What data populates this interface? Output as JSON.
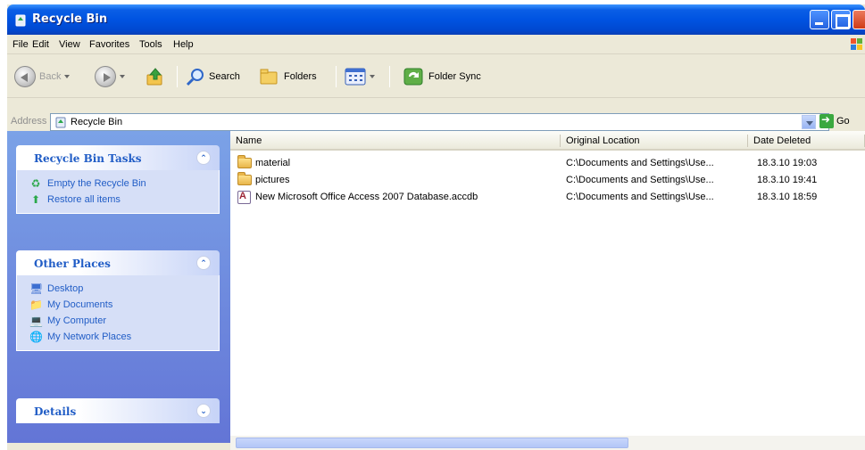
{
  "window": {
    "title": "Recycle Bin"
  },
  "menu": [
    "File",
    "Edit",
    "View",
    "Favorites",
    "Tools",
    "Help"
  ],
  "toolbar": {
    "back_label": "Back",
    "search_label": "Search",
    "folders_label": "Folders",
    "folder_sync_label": "Folder Sync"
  },
  "address": {
    "label": "Address",
    "value": "Recycle Bin",
    "go_label": "Go"
  },
  "task_pane": {
    "recycle_bin_tasks": {
      "title": "Recycle Bin Tasks",
      "items": [
        "Empty the Recycle Bin",
        "Restore all items"
      ]
    },
    "other_places": {
      "title": "Other Places",
      "items": [
        "Desktop",
        "My Documents",
        "My Computer",
        "My Network Places"
      ]
    },
    "details": {
      "title": "Details"
    }
  },
  "file_list": {
    "columns": [
      "Name",
      "Original Location",
      "Date Deleted"
    ],
    "rows": [
      {
        "icon": "folder-icon",
        "name": "material",
        "location": "C:\\Documents and Settings\\Use...",
        "date": "18.3.10 19:03"
      },
      {
        "icon": "folder-icon",
        "name": "pictures",
        "location": "C:\\Documents and Settings\\Use...",
        "date": "18.3.10 19:41"
      },
      {
        "icon": "access-database-icon",
        "name": "New Microsoft Office Access 2007 Database.accdb",
        "location": "C:\\Documents and Settings\\Use...",
        "date": "18.3.10 18:59"
      }
    ]
  },
  "colors": {
    "title_bar": "#0053e1",
    "task_pane": "#6f8de0",
    "link": "#215dc6"
  }
}
